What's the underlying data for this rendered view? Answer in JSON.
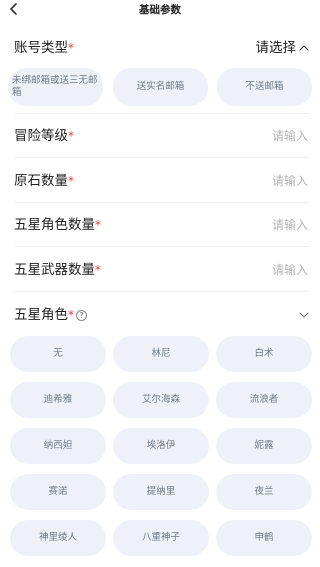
{
  "header": {
    "title": "基础参数"
  },
  "account_type": {
    "label": "账号类型",
    "required_mark": "*",
    "value": "请选择"
  },
  "mail_options": [
    "未绑邮箱或送三无邮箱",
    "送实名邮箱",
    "不送邮箱"
  ],
  "adventure_rank": {
    "label": "冒险等级",
    "required_mark": "*",
    "placeholder": "请输入"
  },
  "primogems": {
    "label": "原石数量",
    "required_mark": "*",
    "placeholder": "请输入"
  },
  "five_star_char_count": {
    "label": "五星角色数量",
    "required_mark": "*",
    "placeholder": "请输入"
  },
  "five_star_weapon_count": {
    "label": "五星武器数量",
    "required_mark": "*",
    "placeholder": "请输入"
  },
  "five_star_chars": {
    "label": "五星角色",
    "required_mark": "*",
    "options": [
      "无",
      "林尼",
      "白术",
      "迪希雅",
      "艾尔海森",
      "流浪者",
      "纳西妲",
      "埃洛伊",
      "妮露",
      "赛诺",
      "提纳里",
      "夜兰",
      "神里绫人",
      "八重神子",
      "申鹤"
    ]
  },
  "icons": [
    "chevron-left-icon",
    "chevron-up-icon",
    "chevron-down-icon",
    "help-circle-icon"
  ],
  "colors": {
    "required": "#e23c3c",
    "pill_bg": "#eef2f8",
    "placeholder": "#b5b5b5"
  }
}
